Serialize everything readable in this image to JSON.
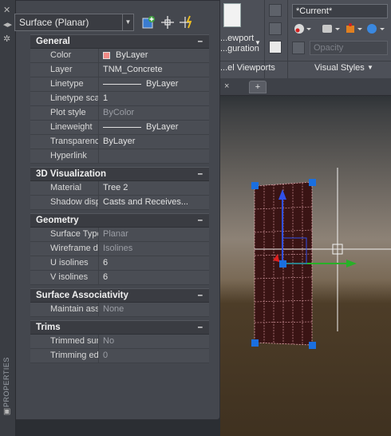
{
  "palette": {
    "side_label": "PROPERTIES",
    "object_type": "Surface (Planar)",
    "toolbar_icons": [
      "toggle-pickadd-icon",
      "select-objects-icon",
      "quick-select-icon"
    ],
    "sections": {
      "general": {
        "title": "General",
        "collapse": "–",
        "rows": {
          "color": {
            "name": "Color",
            "value": "ByLayer",
            "swatch": "#f08a86"
          },
          "layer": {
            "name": "Layer",
            "value": "TNM_Concrete"
          },
          "linetype": {
            "name": "Linetype",
            "value": "ByLayer"
          },
          "linetype_scale": {
            "name": "Linetype scale",
            "value": "1"
          },
          "plot_style": {
            "name": "Plot style",
            "value": "ByColor"
          },
          "lineweight": {
            "name": "Lineweight",
            "value": "ByLayer"
          },
          "transparency": {
            "name": "Transparency",
            "value": "ByLayer"
          },
          "hyperlink": {
            "name": "Hyperlink",
            "value": ""
          }
        }
      },
      "visualization": {
        "title": "3D Visualization",
        "collapse": "–",
        "rows": {
          "material": {
            "name": "Material",
            "value": "Tree 2"
          },
          "shadow": {
            "name": "Shadow display",
            "value": "Casts and Receives..."
          }
        }
      },
      "geometry": {
        "title": "Geometry",
        "collapse": "–",
        "rows": {
          "surface_type": {
            "name": "Surface Type",
            "value": "Planar"
          },
          "wireframe": {
            "name": "Wireframe dis...",
            "value": "Isolines"
          },
          "u_isolines": {
            "name": "U isolines",
            "value": "6"
          },
          "v_isolines": {
            "name": "V isolines",
            "value": "6"
          }
        }
      },
      "associativity": {
        "title": "Surface Associativity",
        "collapse": "–",
        "rows": {
          "maintain": {
            "name": "Maintain assoc...",
            "value": "None"
          }
        }
      },
      "trims": {
        "title": "Trims",
        "collapse": "–",
        "rows": {
          "trimmed": {
            "name": "Trimmed surfa...",
            "value": "No"
          },
          "edges": {
            "name": "Trimming edges",
            "value": "0"
          }
        }
      }
    }
  },
  "ribbon": {
    "viewport_config_line1": "...ewport",
    "viewport_config_line2": "...guration",
    "visual_style_current": "*Current*",
    "opacity_placeholder": "Opacity",
    "panel_viewports": "...el Viewports",
    "panel_visual_styles": "Visual Styles"
  },
  "tabs": {
    "close": "×",
    "new_tab": "+"
  },
  "colors": {
    "surface_fill": "#3a1414",
    "surface_isolines": "#e8a8b0",
    "grip": "#1a6fe0",
    "gizmo_x": "#e02020",
    "gizmo_y": "#28b028",
    "gizmo_z": "#3050e8"
  }
}
